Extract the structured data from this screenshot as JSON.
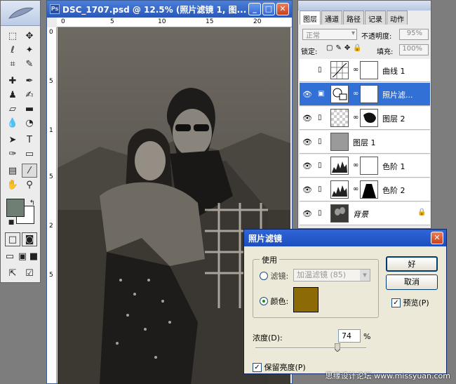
{
  "document": {
    "title": "DSC_1707.psd @ 12.5% (照片滤镜 1, 图...",
    "ruler_h": [
      "0",
      "5",
      "10",
      "15",
      "20"
    ],
    "ruler_v": [
      "0",
      "5",
      "1",
      "5",
      "2",
      "5"
    ]
  },
  "layers_panel": {
    "tabs": [
      "图层",
      "通道",
      "路径",
      "记录",
      "动作"
    ],
    "blend_mode": "正常",
    "opacity_label": "不透明度:",
    "opacity_value": "95%",
    "lock_label": "锁定:",
    "fill_label": "填充:",
    "fill_value": "100%",
    "layers": [
      {
        "name": "曲线 1",
        "visible": false,
        "selected": false
      },
      {
        "name": "照片滤...",
        "visible": true,
        "selected": true
      },
      {
        "name": "图层 2",
        "visible": true,
        "selected": false
      },
      {
        "name": "图层 1",
        "visible": true,
        "selected": false
      },
      {
        "name": "色阶 1",
        "visible": true,
        "selected": false
      },
      {
        "name": "色阶 2",
        "visible": true,
        "selected": false
      },
      {
        "name": "背景",
        "visible": true,
        "selected": false
      }
    ]
  },
  "dialog": {
    "title": "照片滤镜",
    "group_label": "使用",
    "filter_label": "滤镜:",
    "filter_value": "加温滤镜 (85)",
    "color_label": "颜色:",
    "filter_color": "#8c6a06",
    "density_label": "浓度(D):",
    "density_value": "74",
    "density_unit": "%",
    "density_fraction": 0.74,
    "preserve_label": "保留亮度(P)",
    "ok_label": "好",
    "cancel_label": "取消",
    "preview_label": "预览(P)"
  },
  "toolbox": {
    "foreground_color": "#6f7f74"
  },
  "watermark": "思缘设计论坛  www.missyuan.com"
}
